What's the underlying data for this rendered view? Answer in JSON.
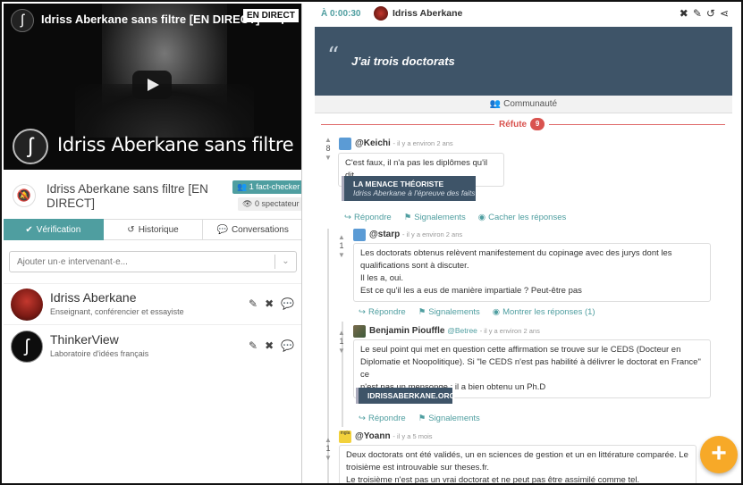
{
  "colors": {
    "accent": "#4f9ea0",
    "quote_bg": "#3e5468",
    "refute": "#d9534f",
    "fab": "#f7a928"
  },
  "video": {
    "title": "Idriss Aberkane sans filtre [EN DIRECT]",
    "live_tag": "EN DIRECT",
    "brand_text": "Idriss Aberkane sans filtre"
  },
  "event": {
    "title": "Idriss Aberkane sans filtre [EN DIRECT]",
    "fact_checker_badge": "1 fact-checker",
    "spectator_badge": "0 spectateur"
  },
  "tabs": [
    {
      "label": "Vérification",
      "icon": "check-circle-icon",
      "active": true
    },
    {
      "label": "Historique",
      "icon": "history-icon",
      "active": false
    },
    {
      "label": "Conversations",
      "icon": "chat-icon",
      "active": false
    }
  ],
  "add_speaker": {
    "placeholder": "Ajouter un·e intervenant·e..."
  },
  "speakers": [
    {
      "name": "Idriss Aberkane",
      "description": "Enseignant, conférencier et essayiste"
    },
    {
      "name": "ThinkerView",
      "description": "Laboratoire d'idées français"
    }
  ],
  "statement": {
    "time": "À 0:00:30",
    "speaker": "Idriss Aberkane",
    "quote": "J'ai trois doctorats"
  },
  "community_label": "Communauté",
  "refute": {
    "label": "Réfute",
    "count": "9"
  },
  "comments": {
    "c1": {
      "user": "@Keichi",
      "meta": "- il y a environ 2 ans",
      "score": "8",
      "text": "C'est faux, il n'a pas les diplômes qu'il dit.",
      "source_title": "LA MENACE THÉORISTE",
      "source_subtitle": "Idriss Aberkane à l'épreuve des faits",
      "actions": [
        "Répondre",
        "Signalements",
        "Cacher les réponses"
      ]
    },
    "c2": {
      "user": "@starp",
      "meta": "- il y a environ 2 ans",
      "score": "1",
      "lines": [
        "Les doctorats obtenus relèvent manifestement du copinage avec des jurys dont les",
        "qualifications sont à discuter.",
        "Il les a, oui.",
        "Est ce qu'il les a eus de manière impartiale ? Peut-être pas"
      ],
      "actions": [
        "Répondre",
        "Signalements",
        "Montrer les réponses (1)"
      ]
    },
    "c3": {
      "user": "Benjamin Piouffle",
      "handle": "@Betree",
      "meta": "- il y a environ 2 ans",
      "score": "1",
      "lines": [
        "Le seul point qui met en question cette affirmation se trouve sur le CEDS (Docteur en",
        "Diplomatie et Noopolitique). Si \"le CEDS n'est pas habilité à délivrer le doctorat en France\" ce",
        "n'est pas un mensonge : il a bien obtenu un Ph.D"
      ],
      "source_title": "IDRISSABERKANE.ORG",
      "actions": [
        "Répondre",
        "Signalements"
      ]
    },
    "c4": {
      "user": "@Yoann",
      "meta": "- il y a 5 mois",
      "score": "1",
      "avatar_text": "mgla",
      "lines": [
        "Deux doctorats ont été validés, un en sciences de gestion et un en littérature comparée. Le",
        "troisième est introuvable sur theses.fr.",
        "Le troisième n'est pas un vrai doctorat et ne peut pas être assimilé comme tel."
      ]
    }
  },
  "fab_label": "+"
}
